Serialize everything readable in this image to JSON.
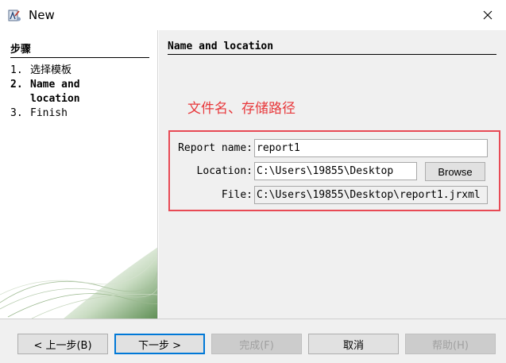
{
  "window": {
    "title": "New",
    "app_icon": "report-designer-icon",
    "close_icon": "close-icon"
  },
  "sidebar": {
    "title": "步骤",
    "steps": [
      {
        "num": "1.",
        "label": "选择模板",
        "current": false
      },
      {
        "num": "2.",
        "label": "Name and location",
        "current": true
      },
      {
        "num": "3.",
        "label": "Finish",
        "current": false
      }
    ]
  },
  "content": {
    "title": "Name and location",
    "annotation": "文件名、存储路径",
    "annotation_color": "#e8383b",
    "form": {
      "report_name_label": "Report name:",
      "report_name_value": "report1",
      "location_label": "Location:",
      "location_value": "C:\\Users\\19855\\Desktop",
      "browse_label": "Browse",
      "file_label": "File:",
      "file_value": "C:\\Users\\19855\\Desktop\\report1.jrxml"
    }
  },
  "buttons": {
    "back": "< 上一步(B)",
    "next": "下一步 >",
    "finish": "完成(F)",
    "cancel": "取消",
    "help": "帮助(H)"
  },
  "colors": {
    "accent_focus": "#0078d7",
    "annotation_box": "#e84a55"
  }
}
